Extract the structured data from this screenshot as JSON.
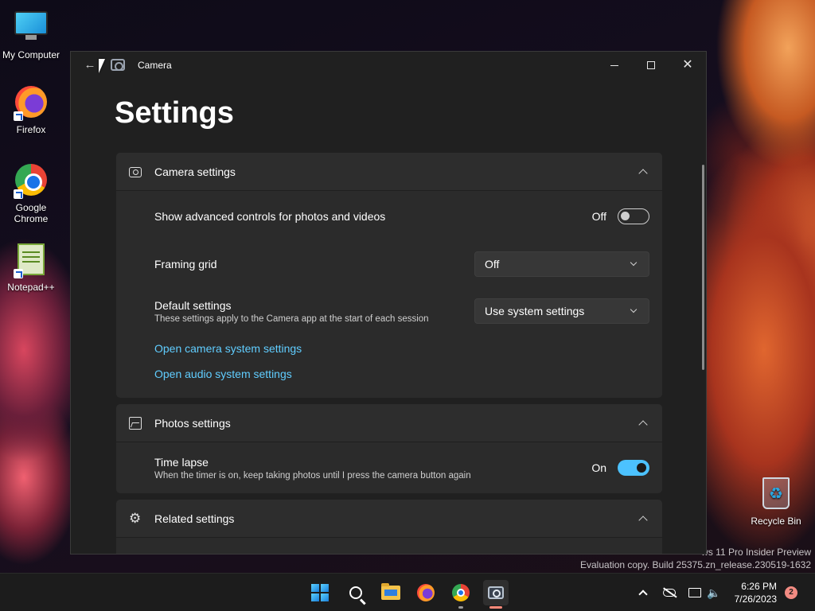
{
  "desktop": {
    "icons": [
      {
        "label": "My Computer"
      },
      {
        "label": "Firefox"
      },
      {
        "label": "Google Chrome"
      },
      {
        "label": "Notepad++"
      },
      {
        "label": "Recycle Bin"
      }
    ],
    "watermark": {
      "line1": "ws 11 Pro Insider Preview",
      "line2": "Evaluation copy. Build 25375.zn_release.230519-1632"
    }
  },
  "window": {
    "title": "Camera",
    "controls": {
      "minimize": "—",
      "maximize": "☐",
      "close": "✕"
    }
  },
  "page": {
    "title": "Settings"
  },
  "camera_settings": {
    "header": "Camera settings",
    "advanced_controls": {
      "title": "Show advanced controls for photos and videos",
      "state_label": "Off",
      "value": false
    },
    "framing_grid": {
      "title": "Framing grid",
      "selected": "Off"
    },
    "default_settings": {
      "title": "Default settings",
      "subtitle": "These settings apply to the Camera app at the start of each session",
      "selected": "Use system settings"
    },
    "links": [
      "Open camera system settings",
      "Open audio system settings"
    ]
  },
  "photos_settings": {
    "header": "Photos settings",
    "time_lapse": {
      "title": "Time lapse",
      "subtitle": "When the timer is on, keep taking photos until I press the camera button again",
      "state_label": "On",
      "value": true
    }
  },
  "related_settings": {
    "header": "Related settings"
  },
  "taskbar": {
    "clock": {
      "time": "6:26 PM",
      "date": "7/26/2023"
    },
    "notification_count": "2"
  },
  "colors": {
    "accent": "#4cc2ff",
    "link": "#60cdff",
    "window_bg": "#202020",
    "card_bg": "#2b2b2b"
  }
}
